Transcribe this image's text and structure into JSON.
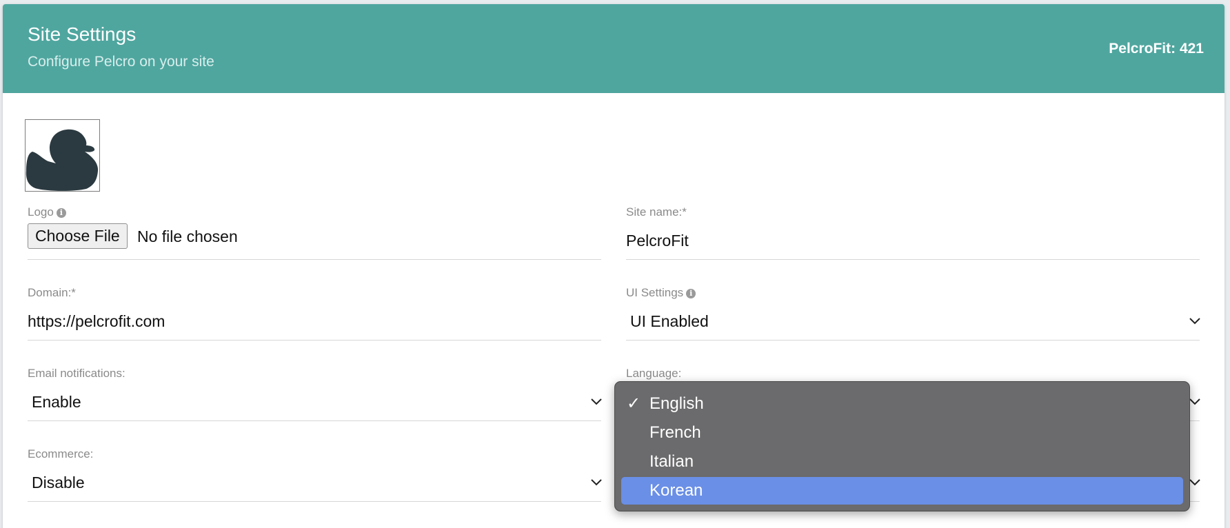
{
  "header": {
    "title": "Site Settings",
    "subtitle": "Configure Pelcro on your site",
    "site_label": "PelcroFit: 421"
  },
  "logo": {
    "label": "Logo",
    "icon": "duck-silhouette-icon",
    "choose_file_label": "Choose File",
    "file_status": "No file chosen"
  },
  "site_name": {
    "label": "Site name:*",
    "value": "PelcroFit"
  },
  "domain": {
    "label": "Domain:*",
    "value": "https://pelcrofit.com"
  },
  "ui_settings": {
    "label": "UI Settings",
    "value": "UI Enabled"
  },
  "email_notifications": {
    "label": "Email notifications:",
    "value": "Enable"
  },
  "language": {
    "label": "Language:",
    "options": [
      "English",
      "French",
      "Italian",
      "Korean"
    ],
    "selected": "English",
    "highlighted": "Korean",
    "check_mark": "✓"
  },
  "ecommerce": {
    "label": "Ecommerce:",
    "value": "Disable"
  },
  "colors": {
    "header_bg": "#4fa69f",
    "menu_bg": "#6b6a6c",
    "menu_highlight": "#6a8fe6",
    "logo_fill": "#2b3a40"
  }
}
